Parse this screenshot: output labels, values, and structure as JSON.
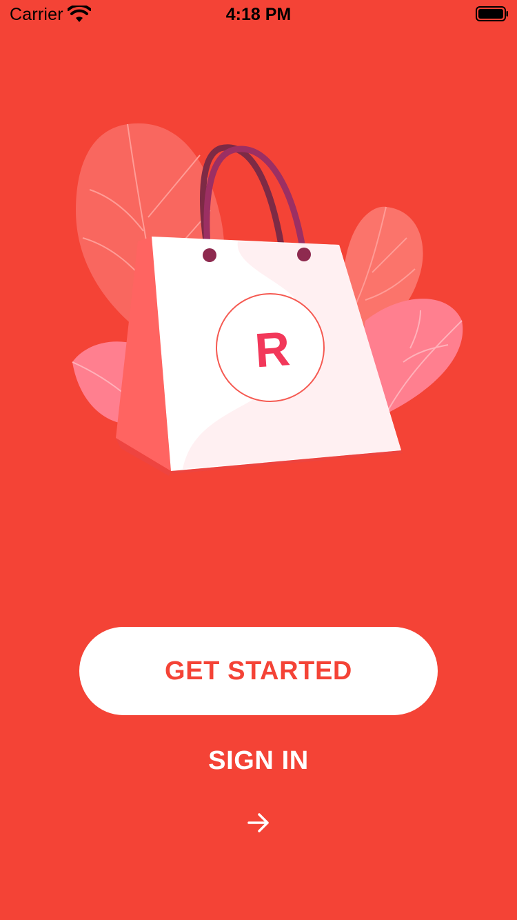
{
  "status_bar": {
    "carrier": "Carrier",
    "time": "4:18 PM",
    "icons": [
      "wifi-icon",
      "battery-icon"
    ]
  },
  "hero": {
    "logo_letter": "R",
    "colors": {
      "background": "#f44336",
      "leaf": "#ff7f8f",
      "bag": "#ffffff",
      "bag_side": "#ff5a5f",
      "handle": "#8e2a4f",
      "logo": "#f2385a"
    }
  },
  "actions": {
    "get_started_label": "GET STARTED",
    "sign_in_label": "SIGN IN",
    "next_icon": "arrow-right-icon"
  }
}
